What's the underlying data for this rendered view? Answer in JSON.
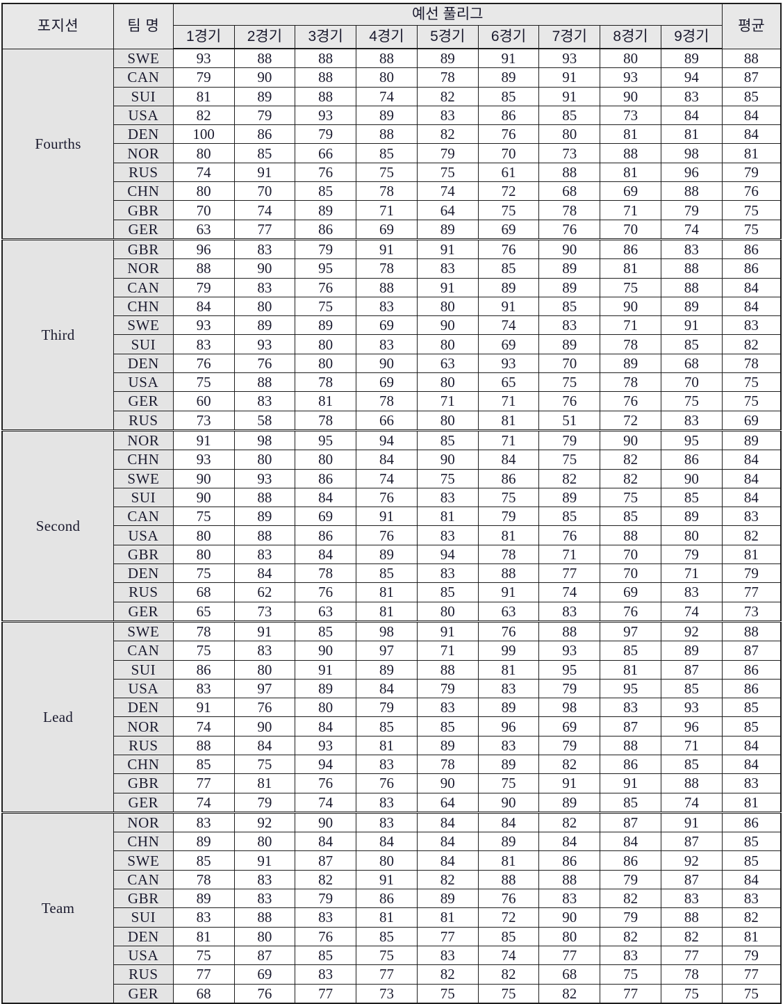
{
  "header": {
    "position_label": "포지션",
    "team_label": "팀 명",
    "group_label": "예선 풀리그",
    "average_label": "평균",
    "games": [
      "1경기",
      "2경기",
      "3경기",
      "4경기",
      "5경기",
      "6경기",
      "7경기",
      "8경기",
      "9경기"
    ]
  },
  "chart_data": {
    "type": "table",
    "title": "예선 풀리그",
    "row_group_label": "포지션",
    "row_label": "팀 명",
    "columns": [
      "1경기",
      "2경기",
      "3경기",
      "4경기",
      "5경기",
      "6경기",
      "7경기",
      "8경기",
      "9경기",
      "평균"
    ],
    "groups": [
      {
        "position": "Fourths",
        "rows": [
          {
            "team": "SWE",
            "values": [
              93,
              88,
              88,
              88,
              89,
              91,
              93,
              80,
              89
            ],
            "average": 88
          },
          {
            "team": "CAN",
            "values": [
              79,
              90,
              88,
              80,
              78,
              89,
              91,
              93,
              94
            ],
            "average": 87
          },
          {
            "team": "SUI",
            "values": [
              81,
              89,
              88,
              74,
              82,
              85,
              91,
              90,
              83
            ],
            "average": 85
          },
          {
            "team": "USA",
            "values": [
              82,
              79,
              93,
              89,
              83,
              86,
              85,
              73,
              84
            ],
            "average": 84
          },
          {
            "team": "DEN",
            "values": [
              100,
              86,
              79,
              88,
              82,
              76,
              80,
              81,
              81
            ],
            "average": 84
          },
          {
            "team": "NOR",
            "values": [
              80,
              85,
              66,
              85,
              79,
              70,
              73,
              88,
              98
            ],
            "average": 81
          },
          {
            "team": "RUS",
            "values": [
              74,
              91,
              76,
              75,
              75,
              61,
              88,
              81,
              96
            ],
            "average": 79
          },
          {
            "team": "CHN",
            "values": [
              80,
              70,
              85,
              78,
              74,
              72,
              68,
              69,
              88
            ],
            "average": 76
          },
          {
            "team": "GBR",
            "values": [
              70,
              74,
              89,
              71,
              64,
              75,
              78,
              71,
              79
            ],
            "average": 75
          },
          {
            "team": "GER",
            "values": [
              63,
              77,
              86,
              69,
              89,
              69,
              76,
              70,
              74
            ],
            "average": 75
          }
        ]
      },
      {
        "position": "Third",
        "rows": [
          {
            "team": "GBR",
            "values": [
              96,
              83,
              79,
              91,
              91,
              76,
              90,
              86,
              83
            ],
            "average": 86
          },
          {
            "team": "NOR",
            "values": [
              88,
              90,
              95,
              78,
              83,
              85,
              89,
              81,
              88
            ],
            "average": 86
          },
          {
            "team": "CAN",
            "values": [
              79,
              83,
              76,
              88,
              91,
              89,
              89,
              75,
              88
            ],
            "average": 84
          },
          {
            "team": "CHN",
            "values": [
              84,
              80,
              75,
              83,
              80,
              91,
              85,
              90,
              89
            ],
            "average": 84
          },
          {
            "team": "SWE",
            "values": [
              93,
              89,
              89,
              69,
              90,
              74,
              83,
              71,
              91
            ],
            "average": 83
          },
          {
            "team": "SUI",
            "values": [
              83,
              93,
              80,
              83,
              80,
              69,
              89,
              78,
              85
            ],
            "average": 82
          },
          {
            "team": "DEN",
            "values": [
              76,
              76,
              80,
              90,
              63,
              93,
              70,
              89,
              68
            ],
            "average": 78
          },
          {
            "team": "USA",
            "values": [
              75,
              88,
              78,
              69,
              80,
              65,
              75,
              78,
              70
            ],
            "average": 75
          },
          {
            "team": "GER",
            "values": [
              60,
              83,
              81,
              78,
              71,
              71,
              76,
              76,
              75
            ],
            "average": 75
          },
          {
            "team": "RUS",
            "values": [
              73,
              58,
              78,
              66,
              80,
              81,
              51,
              72,
              83
            ],
            "average": 69
          }
        ]
      },
      {
        "position": "Second",
        "rows": [
          {
            "team": "NOR",
            "values": [
              91,
              98,
              95,
              94,
              85,
              71,
              79,
              90,
              95
            ],
            "average": 89
          },
          {
            "team": "CHN",
            "values": [
              93,
              80,
              80,
              84,
              90,
              84,
              75,
              82,
              86
            ],
            "average": 84
          },
          {
            "team": "SWE",
            "values": [
              90,
              93,
              86,
              74,
              75,
              86,
              82,
              82,
              90
            ],
            "average": 84
          },
          {
            "team": "SUI",
            "values": [
              90,
              88,
              84,
              76,
              83,
              75,
              89,
              75,
              85
            ],
            "average": 84
          },
          {
            "team": "CAN",
            "values": [
              75,
              89,
              69,
              91,
              81,
              79,
              85,
              85,
              89
            ],
            "average": 83
          },
          {
            "team": "USA",
            "values": [
              80,
              88,
              86,
              76,
              83,
              81,
              76,
              88,
              80
            ],
            "average": 82
          },
          {
            "team": "GBR",
            "values": [
              80,
              83,
              84,
              89,
              94,
              78,
              71,
              70,
              79
            ],
            "average": 81
          },
          {
            "team": "DEN",
            "values": [
              75,
              84,
              78,
              85,
              83,
              88,
              77,
              70,
              71
            ],
            "average": 79
          },
          {
            "team": "RUS",
            "values": [
              68,
              62,
              76,
              81,
              85,
              91,
              74,
              69,
              83
            ],
            "average": 77
          },
          {
            "team": "GER",
            "values": [
              65,
              73,
              63,
              81,
              80,
              63,
              83,
              76,
              74
            ],
            "average": 73
          }
        ]
      },
      {
        "position": "Lead",
        "rows": [
          {
            "team": "SWE",
            "values": [
              78,
              91,
              85,
              98,
              91,
              76,
              88,
              97,
              92
            ],
            "average": 88
          },
          {
            "team": "CAN",
            "values": [
              75,
              83,
              90,
              97,
              71,
              99,
              93,
              85,
              89
            ],
            "average": 87
          },
          {
            "team": "SUI",
            "values": [
              86,
              80,
              91,
              89,
              88,
              81,
              95,
              81,
              87
            ],
            "average": 86
          },
          {
            "team": "USA",
            "values": [
              83,
              97,
              89,
              84,
              79,
              83,
              79,
              95,
              85
            ],
            "average": 86
          },
          {
            "team": "DEN",
            "values": [
              91,
              76,
              80,
              79,
              83,
              89,
              98,
              83,
              93
            ],
            "average": 85
          },
          {
            "team": "NOR",
            "values": [
              74,
              90,
              84,
              85,
              85,
              96,
              69,
              87,
              96
            ],
            "average": 85
          },
          {
            "team": "RUS",
            "values": [
              88,
              84,
              93,
              81,
              89,
              83,
              79,
              88,
              71
            ],
            "average": 84
          },
          {
            "team": "CHN",
            "values": [
              85,
              75,
              94,
              83,
              78,
              89,
              82,
              86,
              85
            ],
            "average": 84
          },
          {
            "team": "GBR",
            "values": [
              77,
              81,
              76,
              76,
              90,
              75,
              91,
              91,
              88
            ],
            "average": 83
          },
          {
            "team": "GER",
            "values": [
              74,
              79,
              74,
              83,
              64,
              90,
              89,
              85,
              74
            ],
            "average": 81
          }
        ]
      },
      {
        "position": "Team",
        "rows": [
          {
            "team": "NOR",
            "values": [
              83,
              92,
              90,
              83,
              84,
              84,
              82,
              87,
              91
            ],
            "average": 86
          },
          {
            "team": "CHN",
            "values": [
              89,
              80,
              84,
              84,
              84,
              89,
              84,
              84,
              87
            ],
            "average": 85
          },
          {
            "team": "SWE",
            "values": [
              85,
              91,
              87,
              80,
              84,
              81,
              86,
              86,
              92
            ],
            "average": 85
          },
          {
            "team": "CAN",
            "values": [
              78,
              83,
              82,
              91,
              82,
              88,
              88,
              79,
              87
            ],
            "average": 84
          },
          {
            "team": "GBR",
            "values": [
              89,
              83,
              79,
              86,
              89,
              76,
              83,
              82,
              83
            ],
            "average": 83
          },
          {
            "team": "SUI",
            "values": [
              83,
              88,
              83,
              81,
              81,
              72,
              90,
              79,
              88
            ],
            "average": 82
          },
          {
            "team": "DEN",
            "values": [
              81,
              80,
              76,
              85,
              77,
              85,
              80,
              82,
              82
            ],
            "average": 81
          },
          {
            "team": "USA",
            "values": [
              75,
              87,
              85,
              75,
              83,
              74,
              77,
              83,
              77
            ],
            "average": 79
          },
          {
            "team": "RUS",
            "values": [
              77,
              69,
              83,
              77,
              82,
              82,
              68,
              75,
              78
            ],
            "average": 77
          },
          {
            "team": "GER",
            "values": [
              68,
              76,
              77,
              73,
              75,
              75,
              82,
              77,
              75
            ],
            "average": 75
          }
        ]
      }
    ]
  }
}
